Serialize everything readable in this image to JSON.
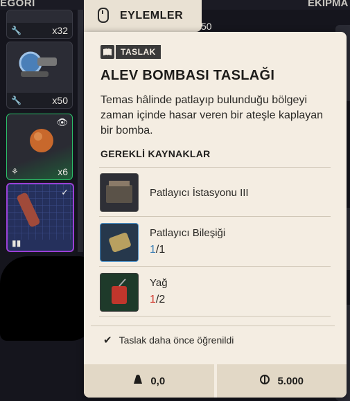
{
  "background": {
    "left_header": "EGORI",
    "right_header": "EKIPMA",
    "slots": [
      {
        "count": "x32",
        "corner": "🔧"
      },
      {
        "count": "x50",
        "corner": "🔧"
      },
      {
        "count": "x6",
        "corner": "⚘"
      },
      {
        "count": "",
        "corner": "▮▮"
      }
    ],
    "partial_count": "50"
  },
  "actions": {
    "label": "EYLEMLER"
  },
  "tooltip": {
    "badge": "TASLAK",
    "title": "ALEV BOMBASI TASLAĞI",
    "description": "Temas hâlinde patlayıp bulunduğu bölgeyi zaman içinde hasar veren bir ateşle kaplayan bir bomba.",
    "requirements_label": "GEREKLİ KAYNAKLAR",
    "resources": [
      {
        "name": "Patlayıcı İstasyonu III",
        "have": "",
        "sep": "",
        "need": ""
      },
      {
        "name": "Patlayıcı Bileşiği",
        "have": "1",
        "sep": "/",
        "need": "1"
      },
      {
        "name": "Yağ",
        "have": "1",
        "sep": "/",
        "need": "2"
      }
    ],
    "learned_text": "Taslak daha önce öğrenildi",
    "weight": "0,0",
    "price": "5.000"
  },
  "colors": {
    "card_bg": "#f4ede2",
    "have_ok": "#3c7fb5",
    "have_missing": "#d23b30"
  }
}
